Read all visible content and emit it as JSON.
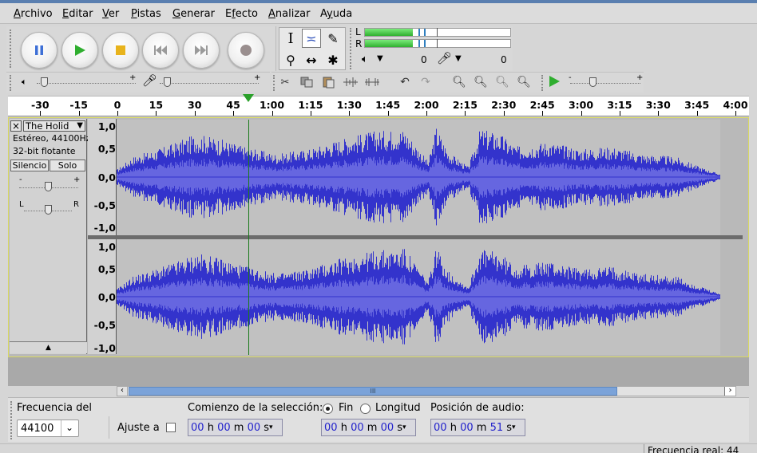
{
  "menu": [
    "Archivo",
    "Editar",
    "Ver",
    "Pistas",
    "Generar",
    "Efecto",
    "Analizar",
    "Ayuda"
  ],
  "menu_underline": [
    "A",
    "E",
    "V",
    "P",
    "G",
    "f",
    "A",
    "y"
  ],
  "transport": [
    {
      "name": "pause-button",
      "icon": "pause-icon"
    },
    {
      "name": "play-button",
      "icon": "play-icon"
    },
    {
      "name": "stop-button",
      "icon": "stop-icon"
    },
    {
      "name": "skip-start-button",
      "icon": "skip-start-icon"
    },
    {
      "name": "skip-end-button",
      "icon": "skip-end-icon"
    },
    {
      "name": "record-button",
      "icon": "record-icon"
    }
  ],
  "tools": {
    "select": "I",
    "envelope": "≍",
    "draw": "✎",
    "zoom": "⚲",
    "timeshift": "↔",
    "multi": "✱"
  },
  "meters": {
    "left_channel": "L",
    "right_channel": "R",
    "left_level": 0.33,
    "right_level": 0.33,
    "playback_value": "0",
    "record_value": "0"
  },
  "mixer": {
    "output_level": 0.25,
    "input_level": 0.25
  },
  "play_at_speed_level": 0.2,
  "ruler": {
    "labels": [
      "-30",
      "-15",
      "0",
      "15",
      "30",
      "45",
      "1:00",
      "1:15",
      "1:30",
      "1:45",
      "2:00",
      "2:15",
      "2:30",
      "2:45",
      "3:00",
      "3:15",
      "3:30",
      "3:45",
      "4:00"
    ],
    "values": [
      -30,
      -15,
      0,
      15,
      30,
      45,
      60,
      75,
      90,
      105,
      120,
      135,
      150,
      165,
      180,
      195,
      210,
      225,
      240
    ],
    "playhead_seconds": 51
  },
  "track": {
    "close": "×",
    "name": "The Holid",
    "format": "Estéreo, 44100Hz",
    "bitdepth": "32-bit flotante",
    "mute": "Silencio",
    "solo": "Solo",
    "gain_minus": "-",
    "gain_plus": "+",
    "pan_left": "L",
    "pan_right": "R",
    "collapse": "▲",
    "amp_labels": [
      "1,0",
      "0,5",
      "0,0",
      "-0,5",
      "-1,0"
    ],
    "cursor_seconds": 51
  },
  "bottom": {
    "rate_label": "Frecuencia del",
    "rate_value": "44100",
    "snap_label": "Ajuste a",
    "sel_start_label": "Comienzo de la selección:",
    "end_option": "Fin",
    "length_option": "Longitud",
    "audio_pos_label": "Posición de audio:",
    "sel_start": {
      "h": "00",
      "m": "00",
      "s": "00"
    },
    "sel_end": {
      "h": "00",
      "m": "00",
      "s": "00"
    },
    "audio_pos": {
      "h": "00",
      "m": "00",
      "s": "51"
    },
    "unit_h": "h",
    "unit_m": "m",
    "unit_s": "s",
    "status": "Frecuencia real: 44"
  },
  "scrollbar_thumb": "III",
  "colors": {
    "wave": "#3333cc",
    "wave_rms": "#6666e0",
    "playhead": "#2aa02a",
    "meter": "#2fb52f"
  }
}
